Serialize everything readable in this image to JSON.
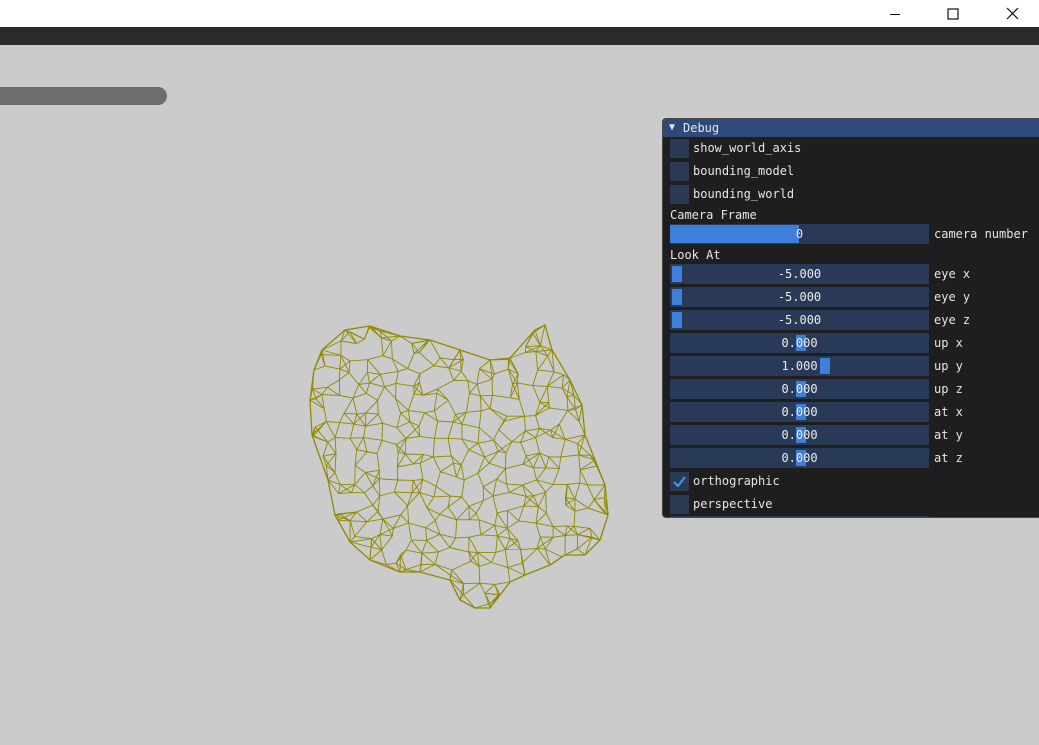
{
  "window": {
    "controls": {
      "minimize": "minimize-icon",
      "maximize": "maximize-icon",
      "close": "close-icon"
    }
  },
  "viewport": {
    "model_color": "#8f8a00",
    "background": "#cbcbcb"
  },
  "panel": {
    "title": "Debug",
    "checkboxes": [
      {
        "label": "show_world_axis",
        "checked": false
      },
      {
        "label": "bounding_model",
        "checked": false
      },
      {
        "label": "bounding_world",
        "checked": false
      }
    ],
    "camera_section": "Camera Frame",
    "camera_slider": {
      "value": "0",
      "label": "camera number",
      "fraction": 0.5
    },
    "lookat_section": "Look At",
    "sliders": [
      {
        "value": "-5.000",
        "label": "eye x",
        "fraction": 0.0
      },
      {
        "value": "-5.000",
        "label": "eye y",
        "fraction": 0.0
      },
      {
        "value": "-5.000",
        "label": "eye z",
        "fraction": 0.0
      },
      {
        "value": "0.000",
        "label": "up x",
        "fraction": 0.5
      },
      {
        "value": "1.000",
        "label": "up y",
        "fraction": 0.6
      },
      {
        "value": "0.000",
        "label": "up z",
        "fraction": 0.5
      },
      {
        "value": "0.000",
        "label": "at x",
        "fraction": 0.5
      },
      {
        "value": "0.000",
        "label": "at y",
        "fraction": 0.5
      },
      {
        "value": "0.000",
        "label": "at z",
        "fraction": 0.5
      }
    ],
    "projection": [
      {
        "label": "orthographic",
        "checked": true
      },
      {
        "label": "perspective",
        "checked": false
      }
    ]
  }
}
